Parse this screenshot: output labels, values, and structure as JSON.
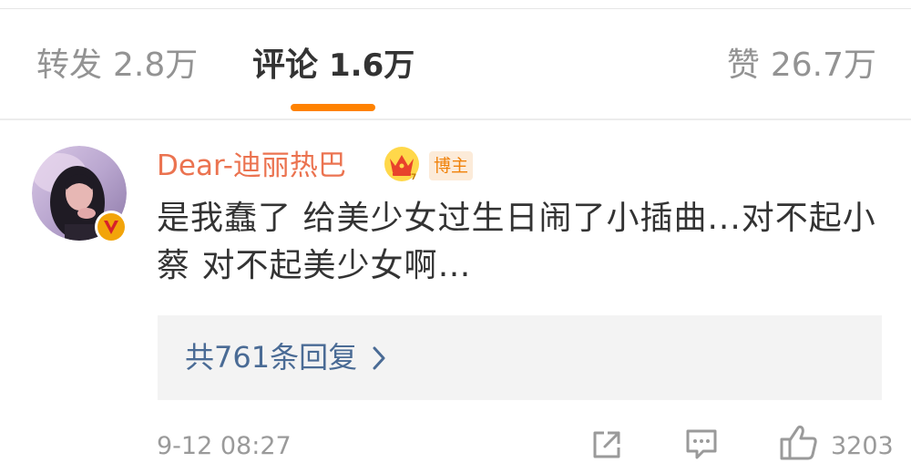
{
  "tabs": {
    "repost": {
      "label": "转发",
      "count": "2.8万"
    },
    "comment": {
      "label": "评论",
      "count": "1.6万"
    },
    "like": {
      "label": "赞",
      "count": "26.7万"
    }
  },
  "comment": {
    "username": "Dear-迪丽热巴",
    "author_badge": "博主",
    "text": "是我蠢了 给美少女过生日闹了小插曲...对不起小蔡 对不起美少女啊…",
    "replies_label": "共761条回复",
    "timestamp": "9-12 08:27",
    "like_count": "3203"
  },
  "icons": {
    "verified": "verified-v-badge",
    "crown": "crown-icon",
    "chevron": "chevron-right-icon",
    "share": "share-external-icon",
    "reply": "comment-bubble-icon",
    "like": "thumbs-up-icon"
  },
  "colors": {
    "accent": "#ff8200",
    "username": "#eb7350",
    "link": "#4a6b95",
    "muted": "#9a9a9a",
    "text": "#333333"
  }
}
